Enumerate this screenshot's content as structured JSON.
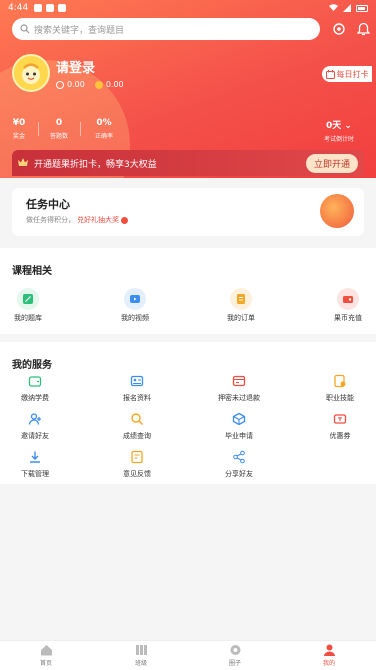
{
  "status_bar": {
    "time": "4:44"
  },
  "search": {
    "placeholder": "搜索关键字，查询题目"
  },
  "profile": {
    "login_label": "请登录",
    "coin1": "0.00",
    "coin2": "0.00",
    "checkin_label": "每日打卡"
  },
  "stats": [
    {
      "value": "¥0",
      "label": "奖金"
    },
    {
      "value": "0",
      "label": "答题数"
    },
    {
      "value": "0%",
      "label": "正确率"
    },
    {
      "value": "0天",
      "label": "考试倒计时"
    }
  ],
  "vip": {
    "text": "开通题果折扣卡，畅享3大权益",
    "button": "立即开通"
  },
  "task": {
    "title": "任务中心",
    "desc": "做任务得积分，",
    "link": "兑好礼抽大奖"
  },
  "course": {
    "title": "课程相关",
    "items": [
      {
        "label": "我的题库",
        "icon": "question-bank-icon",
        "color": "#2bbf7a"
      },
      {
        "label": "我的视频",
        "icon": "video-icon",
        "color": "#3b8df0"
      },
      {
        "label": "我的订单",
        "icon": "order-icon",
        "color": "#f5a623"
      },
      {
        "label": "果币充值",
        "icon": "coin-recharge-icon",
        "color": "#f24e40"
      }
    ]
  },
  "services": {
    "title": "我的服务",
    "items": [
      {
        "label": "缴纳学费",
        "icon": "tuition-icon",
        "color": "#2bbf7a"
      },
      {
        "label": "报名资料",
        "icon": "profile-card-icon",
        "color": "#3b8df0"
      },
      {
        "label": "押密未过退款",
        "icon": "refund-icon",
        "color": "#f24e40"
      },
      {
        "label": "职业技能",
        "icon": "skill-icon",
        "color": "#f5a623"
      },
      {
        "label": "邀请好友",
        "icon": "invite-icon",
        "color": "#3b8df0"
      },
      {
        "label": "成绩查询",
        "icon": "score-search-icon",
        "color": "#f5a623"
      },
      {
        "label": "毕业申请",
        "icon": "graduation-icon",
        "color": "#3b8df0"
      },
      {
        "label": "优惠券",
        "icon": "coupon-icon",
        "color": "#f24e40"
      },
      {
        "label": "下载管理",
        "icon": "download-icon",
        "color": "#3b8df0"
      },
      {
        "label": "意见反馈",
        "icon": "feedback-icon",
        "color": "#f5a623"
      },
      {
        "label": "分享好友",
        "icon": "share-icon",
        "color": "#3b8df0"
      }
    ]
  },
  "tabbar": [
    {
      "label": "首页",
      "icon": "home-icon"
    },
    {
      "label": "班级",
      "icon": "class-icon"
    },
    {
      "label": "圈子",
      "icon": "circle-icon"
    },
    {
      "label": "我的",
      "icon": "profile-icon",
      "active": true
    }
  ],
  "colors": {
    "accent": "#f24e40",
    "header_start": "#ff7a52",
    "vip_bar": "#c8303a"
  }
}
